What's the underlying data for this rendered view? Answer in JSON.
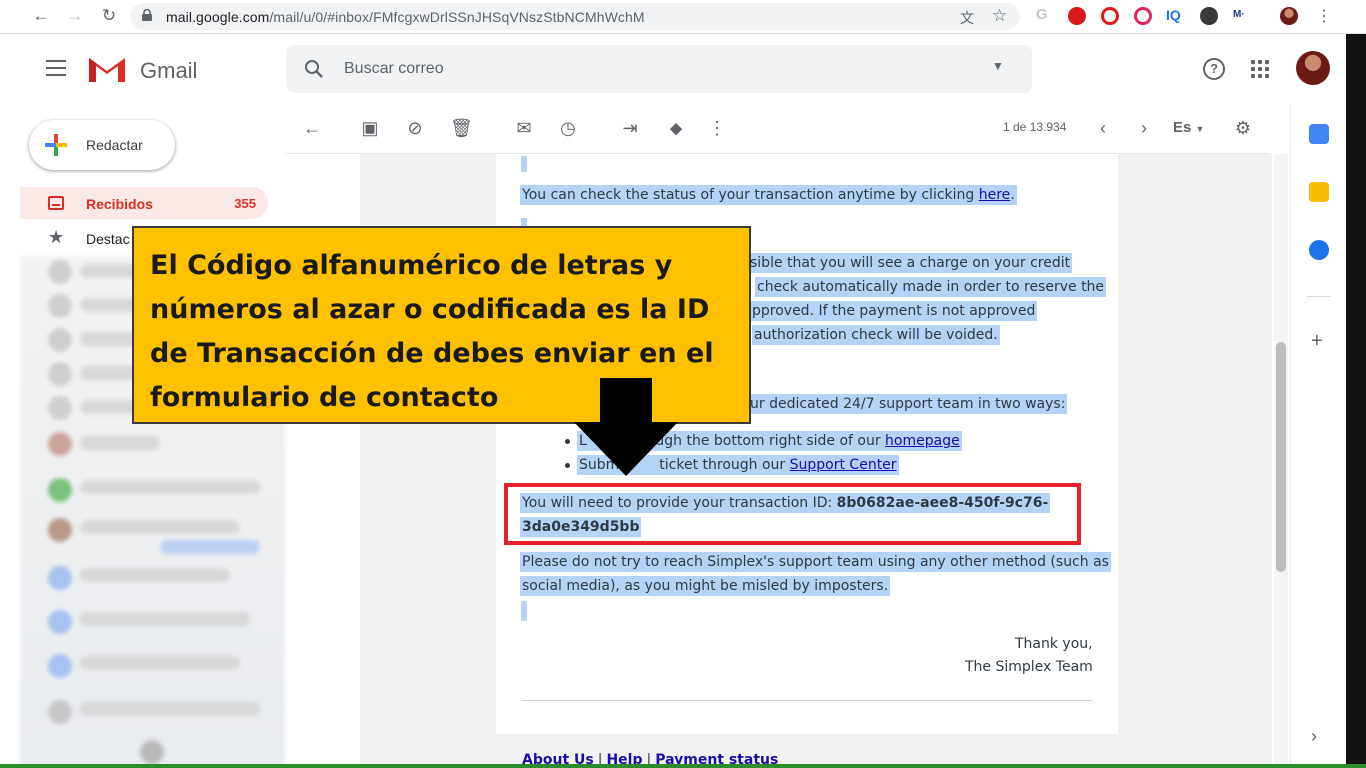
{
  "browser": {
    "url_host": "mail.google.com",
    "url_path": "/mail/u/0/#inbox/FMfcgxwDrlSSnJHSqVNszStbNCMhWchM"
  },
  "header": {
    "app_name": "Gmail",
    "search_placeholder": "Buscar correo"
  },
  "sidebar": {
    "compose_label": "Redactar",
    "items": [
      {
        "label": "Recibidos",
        "count": "355"
      },
      {
        "label": "Destac"
      }
    ]
  },
  "toolbar": {
    "pager": "1 de 13.934",
    "language": "Es"
  },
  "email": {
    "line_status_pre": "You can check the status of your transaction anytime by clicking ",
    "line_status_link": "here",
    "line_status_post": ".",
    "charge_lines": [
      "sible that you will see a charge on your credit",
      "check automatically made in order to reserve the",
      "pproved. If the payment is not approved",
      "authorization check will be voided."
    ],
    "support_line": "ur dedicated 24/7 support team in two ways:",
    "bullet1_pre": "L",
    "bullet1_mid": "ough the bottom right side of our ",
    "bullet1_link": "homepage",
    "bullet2_pre": "Subm",
    "bullet2_mid": "ticket through our ",
    "bullet2_link": "Support Center",
    "txid_label": "You will need to provide your transaction ID: ",
    "txid_part1": "8b0682ae-aee8-450f-9c76-",
    "txid_part2": "3da0e349d5bb",
    "warning_line1": "Please do not try to reach Simplex's support team using any other method (such as",
    "warning_line2": "social media), as you might be misled by imposters.",
    "thanks": "Thank you,",
    "team": "The Simplex Team",
    "footer_links": [
      "About Us",
      "Help",
      "Payment status"
    ],
    "footer_sep": "|"
  },
  "callout": {
    "text": "El Código alfanumérico de letras y números al azar o codificada es la ID de Transacción de debes enviar en el formulario de contacto",
    "background": "#ffc000"
  },
  "colors": {
    "gmail_red": "#d93025",
    "highlight": "#b4d3f7",
    "link": "#1a0dab",
    "red_box": "#e8202b"
  }
}
